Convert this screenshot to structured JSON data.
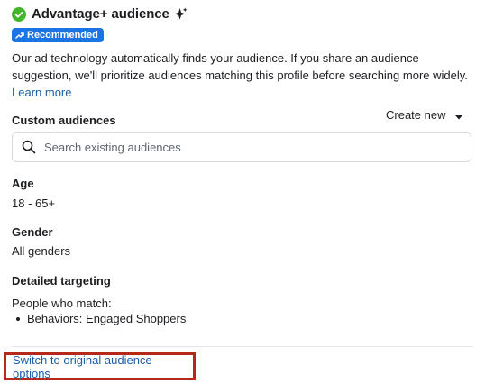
{
  "header": {
    "title": "Advantage+ audience",
    "badge_label": "Recommended"
  },
  "description": {
    "text": "Our ad technology automatically finds your audience. If you share an audience suggestion, we'll prioritize audiences matching this profile before searching more widely.",
    "link_label": "Learn more"
  },
  "custom_audiences": {
    "label": "Custom audiences",
    "create_new_label": "Create new",
    "search_placeholder": "Search existing audiences",
    "search_value": ""
  },
  "age": {
    "label": "Age",
    "value": "18 - 65+"
  },
  "gender": {
    "label": "Gender",
    "value": "All genders"
  },
  "detailed_targeting": {
    "label": "Detailed targeting",
    "intro": "People who match:",
    "items": [
      "Behaviors: Engaged Shoppers"
    ]
  },
  "footer": {
    "switch_link_label": "Switch to original audience options"
  },
  "colors": {
    "accent_blue": "#1b74e4",
    "link_blue": "#1b5fa8",
    "success_green": "#42b72a",
    "highlight_red": "#b5281b"
  },
  "icons": [
    "check-circle-icon",
    "sparkle-icon",
    "trend-icon",
    "caret-down-icon",
    "search-icon"
  ]
}
